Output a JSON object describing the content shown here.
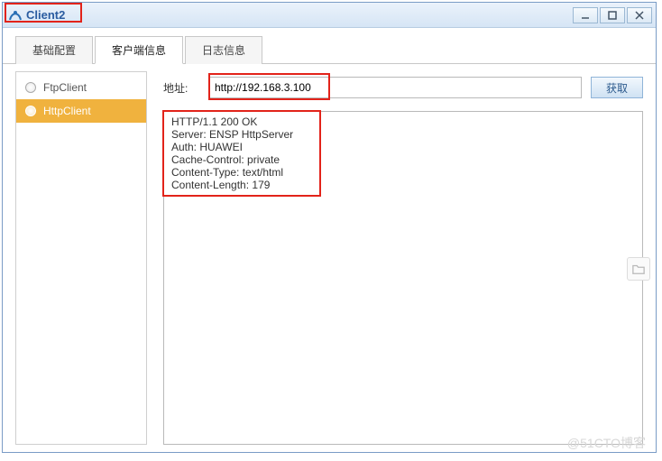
{
  "window": {
    "title": "Client2"
  },
  "tabs": [
    {
      "label": "基础配置"
    },
    {
      "label": "客户端信息"
    },
    {
      "label": "日志信息"
    }
  ],
  "sidebar": {
    "items": [
      {
        "label": "FtpClient"
      },
      {
        "label": "HttpClient"
      }
    ]
  },
  "main": {
    "address_label": "地址:",
    "address_value": "http://192.168.3.100",
    "fetch_label": "获取",
    "response": "HTTP/1.1 200 OK\nServer: ENSP HttpServer\nAuth: HUAWEI\nCache-Control: private\nContent-Type: text/html\nContent-Length: 179"
  },
  "watermark": "@51CTO博客"
}
